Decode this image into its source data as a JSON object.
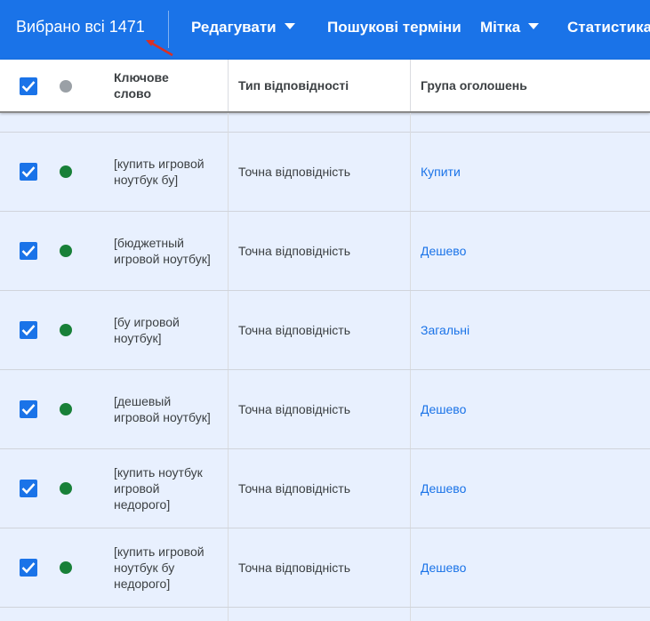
{
  "toolbar": {
    "selected_text": "Вибрано всі 1471",
    "edit_label": "Редагувати",
    "search_terms_label": "Пошукові терміни",
    "label_label": "Мітка",
    "statistics_label": "Статистика"
  },
  "header": {
    "keyword": "Ключове слово",
    "match_type": "Тип відповідності",
    "ad_group": "Група оголошень"
  },
  "colors": {
    "accent": "#1a73e8",
    "enabled_dot": "#188038",
    "header_dot": "#9aa0a6",
    "annotation_arrow": "#d93025"
  },
  "rows": [
    {
      "keyword": "[купить игровой ноутбук бу]",
      "match_type": "Точна відповідність",
      "ad_group": "Купити"
    },
    {
      "keyword": "[бюджетный игровой ноутбук]",
      "match_type": "Точна відповідність",
      "ad_group": "Дешево"
    },
    {
      "keyword": "[бу игровой ноутбук]",
      "match_type": "Точна відповідність",
      "ad_group": "Загальні"
    },
    {
      "keyword": "[дешевый игровой ноутбук]",
      "match_type": "Точна відповідність",
      "ad_group": "Дешево"
    },
    {
      "keyword": "[купить ноутбук игровой недорого]",
      "match_type": "Точна відповідність",
      "ad_group": "Дешево"
    },
    {
      "keyword": "[купить игровой ноутбук бу недорого]",
      "match_type": "Точна відповідність",
      "ad_group": "Дешево"
    }
  ]
}
